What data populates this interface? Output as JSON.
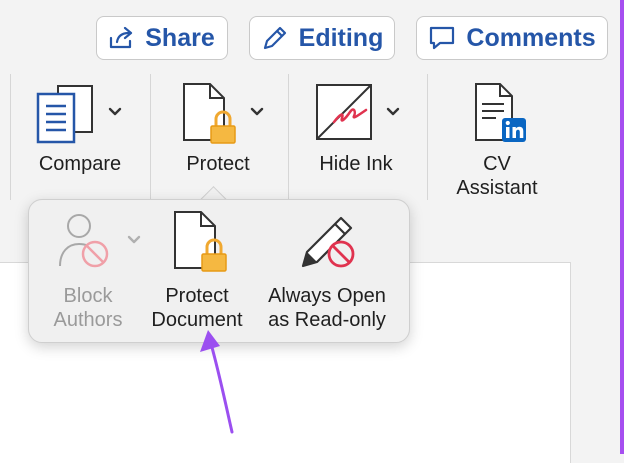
{
  "toolbar": {
    "share_label": "Share",
    "editing_label": "Editing",
    "comments_label": "Comments"
  },
  "ribbon": {
    "compare_label": "Compare",
    "protect_label": "Protect",
    "hide_ink_label": "Hide Ink",
    "cv_line1": "CV",
    "cv_line2": "Assistant"
  },
  "protect_menu": {
    "block_line1": "Block",
    "block_line2": "Authors",
    "protect_line1": "Protect",
    "protect_line2": "Document",
    "always_line1": "Always Open",
    "always_line2": "as Read-only"
  },
  "colors": {
    "accent": "#2556a8",
    "lock": "#f0a830",
    "prohibit": "#e0334f",
    "annotation_arrow": "#9b4ff0"
  }
}
